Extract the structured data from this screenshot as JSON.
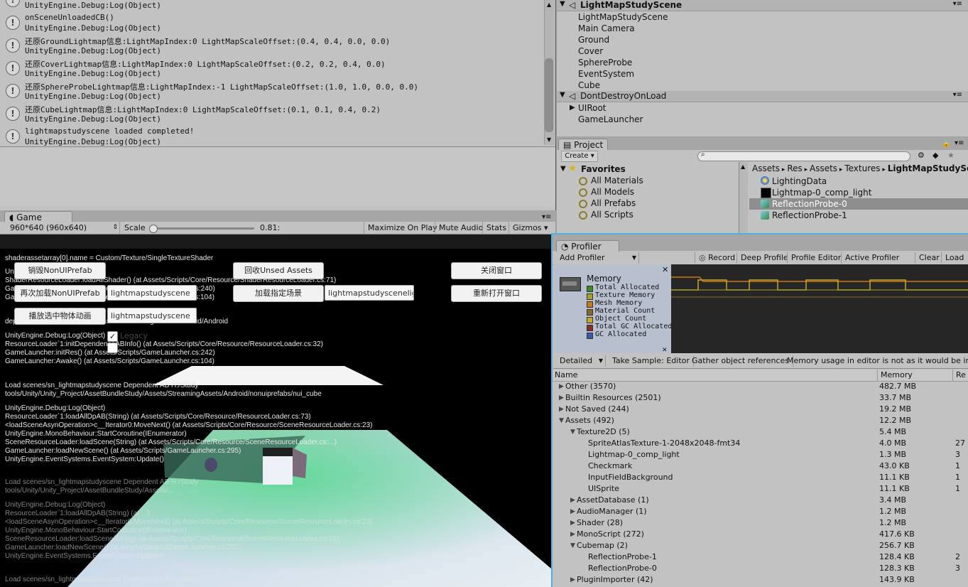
{
  "console": {
    "entries": [
      {
        "line1": "",
        "line2": "UnityEngine.Debug:Log(Object)"
      },
      {
        "line1": "onSceneUnloadedCB()",
        "line2": "UnityEngine.Debug:Log(Object)"
      },
      {
        "line1": "还原GroundLightmap信息:LightMapIndex:0 LightMapScaleOffset:(0.4, 0.4, 0.0, 0.0)",
        "line2": "UnityEngine.Debug:Log(Object)"
      },
      {
        "line1": "还原CoverLightmap信息:LightMapIndex:0 LightMapScaleOffset:(0.2, 0.2, 0.4, 0.0)",
        "line2": "UnityEngine.Debug:Log(Object)"
      },
      {
        "line1": "还原SphereProbeLightmap信息:LightMapIndex:-1 LightMapScaleOffset:(1.0, 1.0, 0.0, 0.0)",
        "line2": "UnityEngine.Debug:Log(Object)"
      },
      {
        "line1": "还原CubeLightmap信息:LightMapIndex:0 LightMapScaleOffset:(0.1, 0.1, 0.4, 0.2)",
        "line2": "UnityEngine.Debug:Log(Object)"
      },
      {
        "line1": "lightmapstudyscene loaded completed!",
        "line2": "UnityEngine.Debug:Log(Object)"
      }
    ],
    "info_icon": "!"
  },
  "hierarchy": {
    "scene1": {
      "name": "LightMapStudyScene",
      "items": [
        "LightMapStudyScene",
        "Main Camera",
        "Ground",
        "Cover",
        "SphereProbe",
        "EventSystem",
        "Cube"
      ]
    },
    "scene2": {
      "name": "DontDestroyOnLoad",
      "items": [
        "UIRoot",
        "GameLauncher"
      ]
    },
    "menu_glyph": "▾≡"
  },
  "project": {
    "tab": "Project",
    "create": "Create ▾",
    "favorites_label": "Favorites",
    "favorites": [
      "All Materials",
      "All Models",
      "All Prefabs",
      "All Scripts"
    ],
    "breadcrumb": [
      "Assets",
      "Res",
      "Assets",
      "Textures",
      "LightMapStudyScene"
    ],
    "assets": [
      "LightingData",
      "Lightmap-0_comp_light",
      "ReflectionProbe-0",
      "ReflectionProbe-1"
    ],
    "selected_asset": 2
  },
  "game": {
    "tab": "Game",
    "resolution": "960*640 (960x640)",
    "scale_label": "Scale",
    "scale_value": "0.81:",
    "scale_level": 0.02,
    "toolbar_buttons": [
      "Maximize On Play",
      "Mute Audio",
      "Stats",
      "Gizmos ▾"
    ],
    "buttons": {
      "destroy_nonui": "销毁NonUIPrefab",
      "recycle_assets": "回收Unsed Assets",
      "close_window": "关闭窗口",
      "reload_nonui": "再次加载NonUIPrefab",
      "load_scene": "加载指定场景",
      "reopen_window": "重新打开窗口",
      "play_anim": "播放选中物体动画"
    },
    "inputs": {
      "reload_input": "lightmapstudyscene",
      "scene_input": "lightmapstudyscenelig",
      "anim_input": "lightmapstudyscene"
    },
    "toggle_label": "Legacy",
    "log_lines": [
      "shaderassetarray[0].name = Custom/Texture/SingleTextureShader",
      "UnityEngine.Debug:Log(Object)",
      "ShaderResourceLoader:loadAllShader() (at Assets/Scripts/Core/Resource/ShaderResourceLoader.cs:71)",
      "GameLauncher:initRes() (at Assets/Scripts/GameLauncher.cs:240)",
      "GameLauncher:Awake() (at Assets/Scripts/GameLauncher.cs:104)",
      "depend ... AssetBundleStudy/Assets/StreamingAssets/Android/Android",
      "UnityEngine.Debug:Log(Object)",
      "ResourceLoader`1:initDependenceABInfo() (at Assets/Scripts/Core/Resource/ResourceLoader.cs:32)",
      "GameLauncher:initRes() (at Assets/Scripts/GameLauncher.cs:242)",
      "GameLauncher:Awake() (at Assets/Scripts/GameLauncher.cs:104)",
      "Load scenes/sn_lightmapstudyscene Dependent AB H:/Study",
      "tools/Unity/Unity_Project/AssetBundleStudy/Assets/StreamingAssets/Android/nonuiprefabs/nui_cube",
      "UnityEngine.Debug:Log(Object)",
      "ResourceLoader`1:loadAllDpAB(String) (at Assets/Scripts/Core/Resource/ResourceLoader.cs:73)",
      "<loadSceneAsynOperation>c__Iterator0:MoveNext() (at Assets/Scripts/Core/Resource/SceneResourceLoader.cs:23)",
      "UnityEngine.MonoBehaviour:StartCoroutine(IEnumerator)",
      "SceneResourceLoader:loadScene(String) (at Assets/Scripts/Core/Resource/SceneResourceLoader.cs:...)",
      "GameLauncher:loadNewScene() (at Assets/Scripts/GameLauncher.cs:295)",
      "UnityEngine.EventSystems.EventSystem:Update()",
      "Load scenes/sn_lightmapstudyscene Dependent AB H:/Study",
      "tools/Unity/Unity_Project/AssetBundleStudy/Assets/...",
      "UnityEngine.Debug:Log(Object)",
      "ResourceLoader`1:loadAllDpAB(String) (at ...)",
      "<loadSceneAsynOperation>c__Iterator0:MoveNext() (at Assets/Scripts/Core/Resource/SceneResourceLoader.cs:23)",
      "UnityEngine.MonoBehaviour:StartCoroutine(IEnumerator)",
      "SceneResourceLoader:loadScene(String) (at Assets/Scripts/Core/Resource/SceneResourceLoader.cs:16)",
      "GameLauncher:loadNewScene() (at Assets/Scripts/GameLauncher.cs:295)",
      "UnityEngine.EventSystems.EventSystem:Update()",
      "Load scenes/sn_lightmapstudyscene Dependent AB H:/Study"
    ]
  },
  "profiler": {
    "tab": "Profiler",
    "add_profiler": "Add Profiler",
    "buttons": [
      "Record",
      "Deep Profile",
      "Profile Editor",
      "Active Profiler",
      "Clear",
      "Load"
    ],
    "memory_title": "Memory",
    "legend": [
      {
        "label": "Total Allocated",
        "color": "#3a8a2a"
      },
      {
        "label": "Texture Memory",
        "color": "#a8a020"
      },
      {
        "label": "Mesh Memory",
        "color": "#c87a1a"
      },
      {
        "label": "Material Count",
        "color": "#8a6a2a"
      },
      {
        "label": "Object Count",
        "color": "#c8a82a"
      },
      {
        "label": "Total GC Allocated",
        "color": "#8a2a2a"
      },
      {
        "label": "GC Allocated",
        "color": "#3a5aa8"
      }
    ],
    "mode": "Detailed",
    "take_sample": "Take Sample: Editor",
    "gather_refs": "Gather object references",
    "notice": "Memory usage in editor is not as it would be in a player",
    "columns": {
      "name": "Name",
      "memory": "Memory",
      "refs": "Re"
    },
    "rows": [
      {
        "name": "Other (3570)",
        "memory": "482.7 MB",
        "refs": "",
        "indent": 0,
        "twist": "▶"
      },
      {
        "name": "Builtin Resources (2501)",
        "memory": "33.7 MB",
        "refs": "",
        "indent": 0,
        "twist": "▶"
      },
      {
        "name": "Not Saved (244)",
        "memory": "19.2 MB",
        "refs": "",
        "indent": 0,
        "twist": "▶"
      },
      {
        "name": "Assets (492)",
        "memory": "12.2 MB",
        "refs": "",
        "indent": 0,
        "twist": "▼"
      },
      {
        "name": "Texture2D (5)",
        "memory": "5.4 MB",
        "refs": "",
        "indent": 1,
        "twist": "▼"
      },
      {
        "name": "SpriteAtlasTexture-1-2048x2048-fmt34",
        "memory": "4.0 MB",
        "refs": "27",
        "indent": 2,
        "twist": ""
      },
      {
        "name": "Lightmap-0_comp_light",
        "memory": "1.3 MB",
        "refs": "3",
        "indent": 2,
        "twist": ""
      },
      {
        "name": "Checkmark",
        "memory": "43.0 KB",
        "refs": "1",
        "indent": 2,
        "twist": ""
      },
      {
        "name": "InputFieldBackground",
        "memory": "11.1 KB",
        "refs": "1",
        "indent": 2,
        "twist": ""
      },
      {
        "name": "UISprite",
        "memory": "11.1 KB",
        "refs": "1",
        "indent": 2,
        "twist": ""
      },
      {
        "name": "AssetDatabase (1)",
        "memory": "3.4 MB",
        "refs": "",
        "indent": 1,
        "twist": "▶"
      },
      {
        "name": "AudioManager (1)",
        "memory": "1.2 MB",
        "refs": "",
        "indent": 1,
        "twist": "▶"
      },
      {
        "name": "Shader (28)",
        "memory": "1.2 MB",
        "refs": "",
        "indent": 1,
        "twist": "▶"
      },
      {
        "name": "MonoScript (272)",
        "memory": "417.6 KB",
        "refs": "",
        "indent": 1,
        "twist": "▶"
      },
      {
        "name": "Cubemap (2)",
        "memory": "256.7 KB",
        "refs": "",
        "indent": 1,
        "twist": "▼"
      },
      {
        "name": "ReflectionProbe-1",
        "memory": "128.4 KB",
        "refs": "2",
        "indent": 2,
        "twist": ""
      },
      {
        "name": "ReflectionProbe-0",
        "memory": "128.3 KB",
        "refs": "3",
        "indent": 2,
        "twist": ""
      },
      {
        "name": "PluginImporter (42)",
        "memory": "143.9 KB",
        "refs": "",
        "indent": 1,
        "twist": "▶"
      }
    ]
  }
}
